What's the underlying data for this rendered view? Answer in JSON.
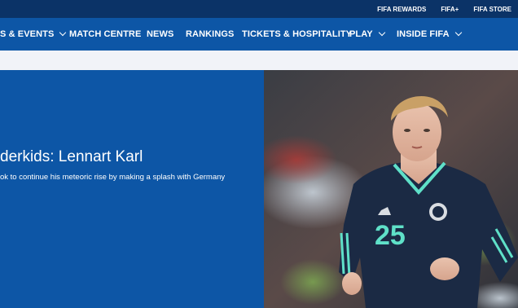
{
  "topbar": {
    "links": [
      "FIFA REWARDS",
      "FIFA+",
      "FIFA STORE"
    ]
  },
  "nav": {
    "items": [
      {
        "label": "S & EVENTS",
        "dropdown": true
      },
      {
        "label": "MATCH CENTRE",
        "dropdown": false
      },
      {
        "label": "NEWS",
        "dropdown": false
      },
      {
        "label": "RANKINGS",
        "dropdown": false
      },
      {
        "label": "TICKETS & HOSPITALITY",
        "dropdown": false
      },
      {
        "label": "PLAY",
        "dropdown": true
      },
      {
        "label": "INSIDE FIFA",
        "dropdown": true
      }
    ]
  },
  "hero": {
    "title": "derkids: Lennart Karl",
    "subtitle": "ok to continue his meteoric rise by making a splash with Germany",
    "image_alt": "player",
    "jersey_number": "25"
  },
  "colors": {
    "topbar": "#0b3367",
    "nav": "#0d56a6",
    "hero_panel": "#0d56a6",
    "subbar": "#f1f3f8",
    "jersey": "#1b2a44",
    "jersey_accent": "#5fe0c8"
  }
}
